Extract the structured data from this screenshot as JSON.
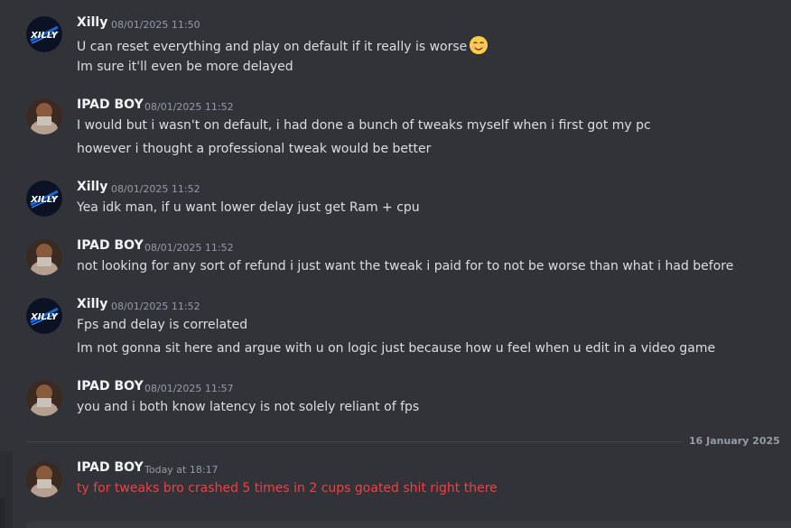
{
  "messages": [
    {
      "author": "Xilly",
      "avatar": "xilly-logo",
      "timestamp": "08/01/2025 11:50",
      "lines": [
        "U can reset everything and play on default if it really is worse",
        "Im sure it'll even be more delayed"
      ],
      "emoji": "smiling-face-emoji"
    },
    {
      "author": "IPAD BOY",
      "avatar": "ipad-boy-photo",
      "timestamp": "08/01/2025 11:52",
      "lines": [
        "I would but i wasn't on default, i had done a bunch of tweaks myself when i first got my pc",
        "however i thought a professional tweak would be better"
      ]
    },
    {
      "author": "Xilly",
      "avatar": "xilly-logo",
      "timestamp": "08/01/2025 11:52",
      "lines": [
        "Yea idk man, if u want lower delay just get Ram + cpu"
      ]
    },
    {
      "author": "IPAD BOY",
      "avatar": "ipad-boy-photo",
      "timestamp": "08/01/2025 11:52",
      "lines": [
        "not looking for any sort of refund i just want the tweak i paid for to not be worse than what i had before"
      ]
    },
    {
      "author": "Xilly",
      "avatar": "xilly-logo",
      "timestamp": "08/01/2025 11:52",
      "lines": [
        "Fps and delay is correlated",
        "Im not gonna sit here and argue with u on logic just because how u feel when u edit in a video game"
      ]
    },
    {
      "author": "IPAD BOY",
      "avatar": "ipad-boy-photo",
      "timestamp": "08/01/2025 11:57",
      "lines": [
        "you and i both know latency is not solely reliant of fps"
      ]
    },
    {
      "author": "IPAD BOY",
      "avatar": "ipad-boy-photo",
      "timestamp": "Today at 18:17",
      "lines": [
        "ty for tweaks bro crashed 5 times in 2 cups goated shit right there"
      ],
      "text_color": "#f23f43"
    }
  ],
  "date_divider": "16 January 2025",
  "colors": {
    "background": "#323339",
    "username": "#f2f3f5",
    "message_text": "#dbdee1",
    "timestamp": "#949ba4",
    "error_text": "#f23f43"
  }
}
